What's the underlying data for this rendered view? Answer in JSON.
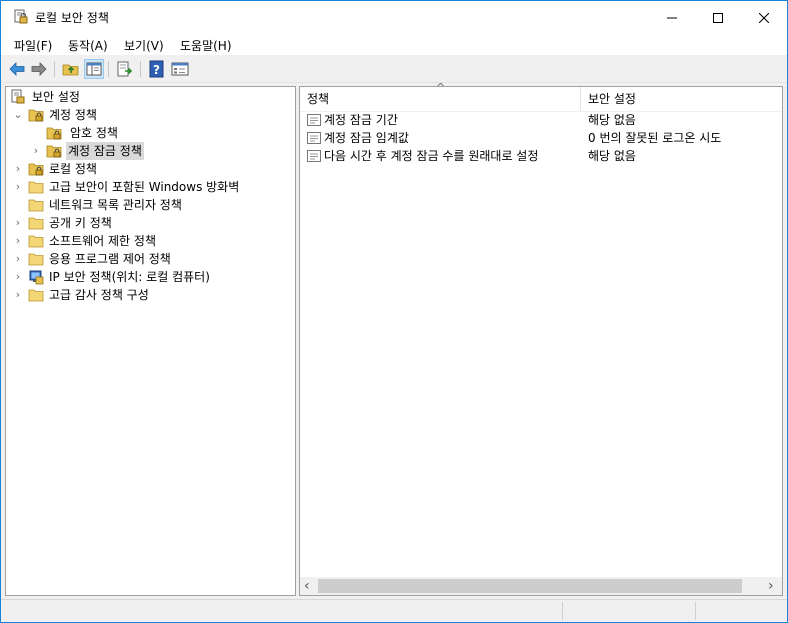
{
  "window": {
    "title": "로컬 보안 정책",
    "controls": {
      "minimize": "—",
      "maximize": "☐",
      "close": "✕"
    }
  },
  "menu": [
    "파일(F)",
    "동작(A)",
    "보기(V)",
    "도움말(H)"
  ],
  "toolbar_icons": [
    "back-arrow-icon",
    "forward-arrow-icon",
    "up-folder-icon",
    "show-hide-tree-icon",
    "export-list-icon",
    "help-icon",
    "properties-icon"
  ],
  "tree": {
    "root": "보안 설정",
    "items": [
      {
        "label": "계정 정책",
        "expander": "⌄"
      },
      {
        "label": "암호 정책",
        "expander": ""
      },
      {
        "label": "계정 잠금 정책",
        "expander": "›"
      },
      {
        "label": "로컬 정책",
        "expander": "›"
      },
      {
        "label": "고급 보안이 포함된 Windows 방화벽",
        "expander": "›"
      },
      {
        "label": "네트워크 목록 관리자 정책",
        "expander": ""
      },
      {
        "label": "공개 키 정책",
        "expander": "›"
      },
      {
        "label": "소프트웨어 제한 정책",
        "expander": "›"
      },
      {
        "label": "응용 프로그램 제어 정책",
        "expander": "›"
      },
      {
        "label": "IP 보안 정책(위치: 로컬 컴퓨터)",
        "expander": "›"
      },
      {
        "label": "고급 감사 정책 구성",
        "expander": "›"
      }
    ]
  },
  "list": {
    "columns": [
      "정책",
      "보안 설정"
    ],
    "sort_glyph": "^",
    "rows": [
      {
        "policy": "계정 잠금 기간",
        "setting": "해당 없음"
      },
      {
        "policy": "계정 잠금 임계값",
        "setting": "0 번의 잘못된 로그온 시도"
      },
      {
        "policy": "다음 시간 후 계정 잠금 수를 원래대로 설정",
        "setting": "해당 없음"
      }
    ]
  },
  "scrollbar": {
    "left": "‹",
    "right": "›"
  },
  "colors": {
    "accent_border": "#1883d7",
    "folder": "#e8c250",
    "selection": "#d9d9d9"
  }
}
